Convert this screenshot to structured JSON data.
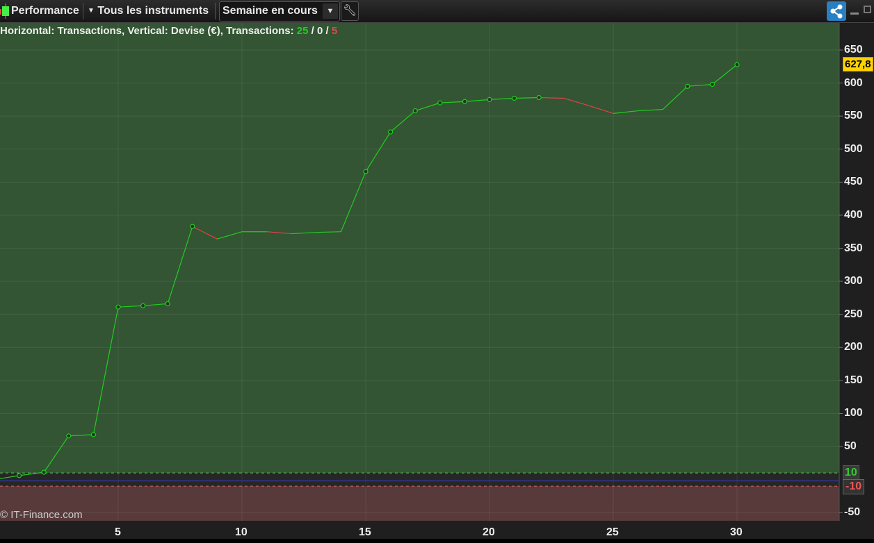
{
  "toolbar": {
    "indicator_label": "Performance",
    "instruments_label": "Tous les instruments",
    "period_label": "Semaine en cours"
  },
  "header": {
    "prefix": "Horizontal: Transactions, Vertical: Devise (€), Transactions: ",
    "wins": "25",
    "sep1": " / ",
    "neutral": "0",
    "sep2": " / ",
    "losses": "5"
  },
  "watermark": "© IT-Finance.com",
  "last_value": "627,8",
  "threshold_labels": {
    "upper": "10",
    "lower": "-10"
  },
  "colors": {
    "up": "#22cc22",
    "down": "#e04444",
    "profit_bg": "#335533",
    "loss_bg": "#583a3a",
    "last_badge": "#ffd200"
  },
  "chart_data": {
    "type": "line",
    "xlabel": "Transactions",
    "ylabel": "Devise (€)",
    "x": [
      0,
      1,
      2,
      3,
      4,
      5,
      6,
      7,
      8,
      9,
      10,
      11,
      12,
      13,
      14,
      15,
      16,
      17,
      18,
      19,
      20,
      21,
      22,
      23,
      24,
      25,
      26,
      27,
      28,
      29,
      30
    ],
    "y": [
      0,
      6,
      11,
      66,
      68,
      261,
      263,
      266,
      383,
      364,
      375,
      375,
      372,
      374,
      375,
      466,
      526,
      558,
      570,
      572,
      575,
      577,
      578,
      577,
      566,
      554,
      558,
      560,
      595,
      598,
      627.8
    ],
    "markers": [
      0,
      1,
      1,
      1,
      1,
      1,
      1,
      1,
      1,
      0,
      0,
      0,
      0,
      0,
      0,
      1,
      1,
      1,
      1,
      1,
      1,
      1,
      1,
      0,
      0,
      0,
      0,
      0,
      1,
      1,
      1
    ],
    "yticks": [
      650,
      600,
      550,
      500,
      450,
      400,
      350,
      300,
      250,
      200,
      150,
      100,
      50,
      -50
    ],
    "xticks": [
      5,
      10,
      15,
      20,
      25,
      30
    ],
    "ylim": [
      -60,
      690
    ],
    "xlim": [
      0.23,
      34.1
    ]
  }
}
